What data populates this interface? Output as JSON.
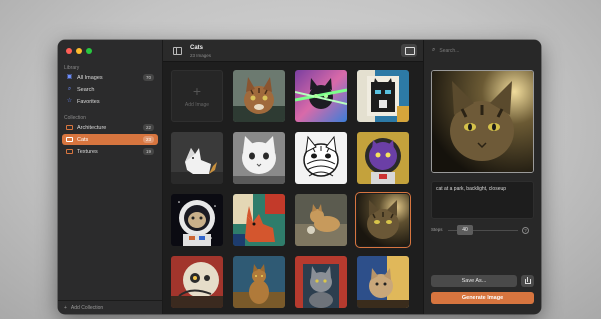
{
  "sidebar": {
    "library_title": "Library",
    "library_items": [
      {
        "label": "All Images",
        "count": "70",
        "icon": "photo-stack-icon"
      },
      {
        "label": "Search",
        "count": "",
        "icon": "search-icon"
      },
      {
        "label": "Favorites",
        "count": "",
        "icon": "star-icon"
      }
    ],
    "collection_title": "Collection",
    "collections": [
      {
        "label": "Architecture",
        "count": "22",
        "active": false
      },
      {
        "label": "Cats",
        "count": "23",
        "active": true
      },
      {
        "label": "Textures",
        "count": "19",
        "active": false
      }
    ],
    "add_collection_label": "Add Collection"
  },
  "header": {
    "title": "Cats",
    "subtitle": "23 Images"
  },
  "grid": {
    "add_label": "Add Image",
    "tiles": [
      {
        "name": "tabby-cat-portrait"
      },
      {
        "name": "cat-laser-eyes"
      },
      {
        "name": "cat-cubist-painting"
      },
      {
        "name": "origami-paper-cat"
      },
      {
        "name": "white-cat-sketch"
      },
      {
        "name": "zentangle-cat"
      },
      {
        "name": "astronaut-cat-purple"
      },
      {
        "name": "astronaut-cat-helmet"
      },
      {
        "name": "cubist-red-cat"
      },
      {
        "name": "cat-with-ball"
      },
      {
        "name": "cat-backlit-closeup"
      },
      {
        "name": "robot-cat"
      },
      {
        "name": "painted-cat-sitting"
      },
      {
        "name": "red-background-cat"
      },
      {
        "name": "cat-in-window"
      }
    ]
  },
  "inspector": {
    "search_placeholder": "Search...",
    "prompt": "cat at a park, backlight, closeup",
    "steps_label": "Steps",
    "steps_value": "40",
    "save_label": "Save As...",
    "generate_label": "Generate Image"
  },
  "colors": {
    "accent": "#d7753f",
    "window_bg": "#242424"
  }
}
